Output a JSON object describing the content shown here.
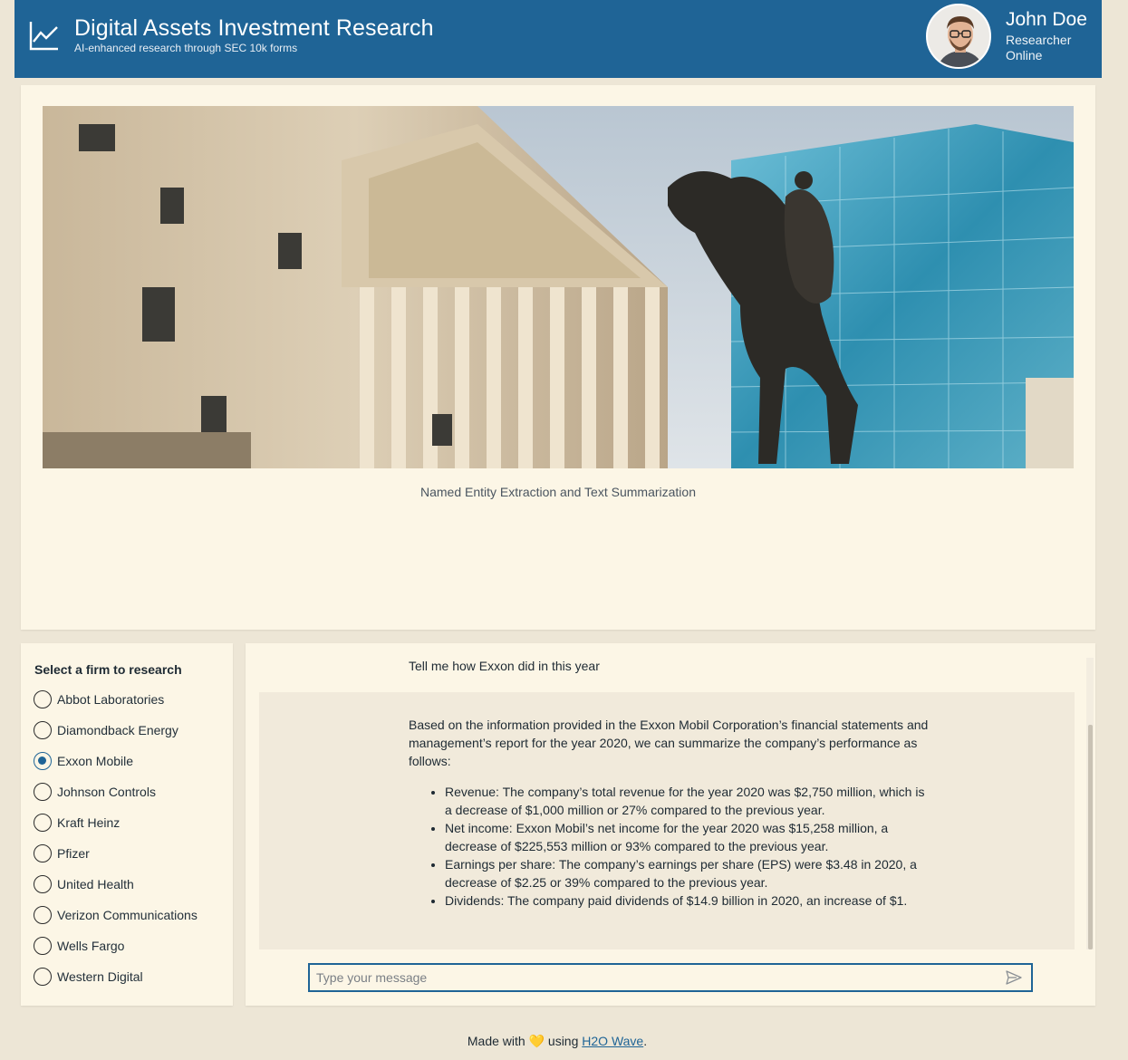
{
  "header": {
    "title": "Digital Assets Investment Research",
    "subtitle": "AI-enhanced research through SEC 10k forms",
    "logo_icon": "line-chart-icon",
    "user": {
      "name": "John Doe",
      "role": "Researcher",
      "status": "Online",
      "avatar_icon": "user-avatar"
    },
    "bg_color": "#1f6496"
  },
  "hero": {
    "image_icon": "bank-building-statue-photo",
    "caption": "Named Entity Extraction and Text Summarization"
  },
  "firms": {
    "heading": "Select a firm to research",
    "options": [
      {
        "label": "Abbot Laboratories",
        "selected": false
      },
      {
        "label": "Diamondback Energy",
        "selected": false
      },
      {
        "label": "Exxon Mobile",
        "selected": true
      },
      {
        "label": "Johnson Controls",
        "selected": false
      },
      {
        "label": "Kraft Heinz",
        "selected": false
      },
      {
        "label": "Pfizer",
        "selected": false
      },
      {
        "label": "United Health",
        "selected": false
      },
      {
        "label": "Verizon Communications",
        "selected": false
      },
      {
        "label": "Wells Fargo",
        "selected": false
      },
      {
        "label": "Western Digital",
        "selected": false
      }
    ]
  },
  "chat": {
    "user_message": "Tell me how Exxon did in this year",
    "bot_intro": "Based on the information provided in the Exxon Mobil Corporation’s financial statements and management’s report for the year 2020, we can summarize the company’s performance as follows:",
    "bot_points": [
      "Revenue: The company’s total revenue for the year 2020 was $2,750 million, which is a decrease of $1,000 million or 27% compared to the previous year.",
      "Net income: Exxon Mobil’s net income for the year 2020 was $15,258 million, a decrease of $225,553 million or 93% compared to the previous year.",
      "Earnings per share: The company’s earnings per share (EPS) were $3.48 in 2020, a decrease of $2.25 or 39% compared to the previous year.",
      "Dividends: The company paid dividends of $14.9 billion in 2020, an increase of $1."
    ],
    "input_placeholder": "Type your message",
    "send_icon": "send-icon"
  },
  "footer": {
    "prefix": "Made with",
    "heart": "💛",
    "middle": "using",
    "link_text": "H2O Wave",
    "suffix": "."
  }
}
